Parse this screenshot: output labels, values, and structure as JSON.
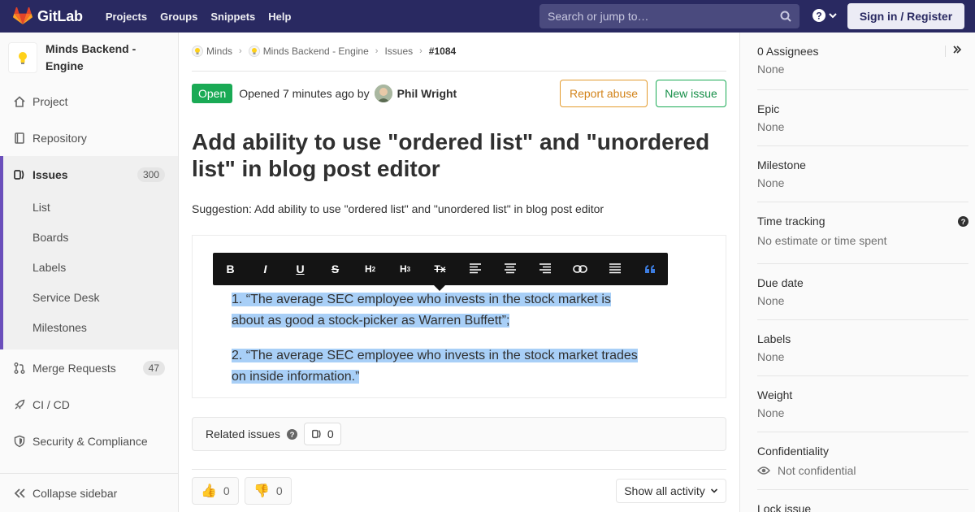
{
  "navbar": {
    "brand": "GitLab",
    "links": [
      "Projects",
      "Groups",
      "Snippets",
      "Help"
    ],
    "search_placeholder": "Search or jump to…",
    "signin": "Sign in / Register"
  },
  "sidebar": {
    "project_name": "Minds Backend - Engine",
    "items": [
      {
        "label": "Project",
        "icon": "home-icon"
      },
      {
        "label": "Repository",
        "icon": "book-icon"
      },
      {
        "label": "Issues",
        "icon": "issues-icon",
        "count": "300"
      },
      {
        "label": "Merge Requests",
        "icon": "merge-request-icon",
        "count": "47"
      },
      {
        "label": "CI / CD",
        "icon": "rocket-icon"
      },
      {
        "label": "Security & Compliance",
        "icon": "shield-icon"
      }
    ],
    "sub_items": [
      "List",
      "Boards",
      "Labels",
      "Service Desk",
      "Milestones"
    ],
    "collapse": "Collapse sidebar"
  },
  "breadcrumb": [
    "Minds",
    "Minds Backend - Engine",
    "Issues",
    "#1084"
  ],
  "issue": {
    "status": "Open",
    "opened": "Opened 7 minutes ago by",
    "author": "Phil Wright",
    "report_label": "Report abuse",
    "new_label": "New issue",
    "title": "Add ability to use \"ordered list\" and \"unordered list\" in blog post editor",
    "description": "Suggestion: Add ability to use \"ordered list\" and \"unordered list\" in blog post editor"
  },
  "screenshot": {
    "toolbar": [
      "B",
      "I",
      "U",
      "S",
      "H2",
      "H3",
      "Tx",
      "align-left",
      "align-center",
      "align-right",
      "link",
      "justify",
      "quote"
    ],
    "line1a": "1. “The average SEC employee who invests in the stock market is",
    "line1b": "about as good a stock-picker as Warren Buffett”;",
    "line2a": "2. “The average SEC employee who invests in the stock market trades",
    "line2b": "on inside information.”"
  },
  "related": {
    "label": "Related issues",
    "count": "0"
  },
  "reactions": {
    "thumbs_up": "0",
    "thumbs_down": "0"
  },
  "activity": "Show all activity",
  "right": {
    "assignees_label": "0 Assignees",
    "assignees_value": "None",
    "epic_label": "Epic",
    "epic_value": "None",
    "milestone_label": "Milestone",
    "milestone_value": "None",
    "time_label": "Time tracking",
    "time_value": "No estimate or time spent",
    "due_label": "Due date",
    "due_value": "None",
    "labels_label": "Labels",
    "labels_value": "None",
    "weight_label": "Weight",
    "weight_value": "None",
    "conf_label": "Confidentiality",
    "conf_value": "Not confidential",
    "lock_label": "Lock issue"
  },
  "colors": {
    "navbar": "#292961",
    "open": "#1aaa55",
    "accent": "#6b4fbb",
    "report": "#e39b2e"
  }
}
